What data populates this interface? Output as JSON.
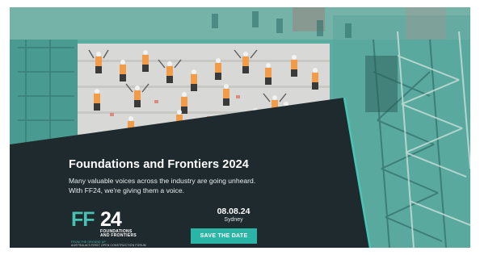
{
  "banner": {
    "headline": "Foundations and Frontiers 2024",
    "subtext_line1": "Many valuable voices across the industry are going unheard.",
    "subtext_line2": "With FF24, we're giving them a voice.",
    "date": "08.08.24",
    "city": "Sydney",
    "cta_label": "SAVE THE DATE"
  },
  "logo": {
    "mark_ff": "FF",
    "mark_24": "24",
    "line1": "FOUNDATIONS",
    "line2": "AND FRONTIERS",
    "tagline": "FROM THE GROUND UP",
    "forum": "AUSTRALIA'S FIRST OPEN CONSTRUCTION FORUM"
  },
  "colors": {
    "panel": "#1f2a2e",
    "teal_accent": "#2bb5a6",
    "overlay_teal": "#46c3b3"
  },
  "icons": [
    "construction-crowd-photo",
    "construction-crane-photo"
  ]
}
